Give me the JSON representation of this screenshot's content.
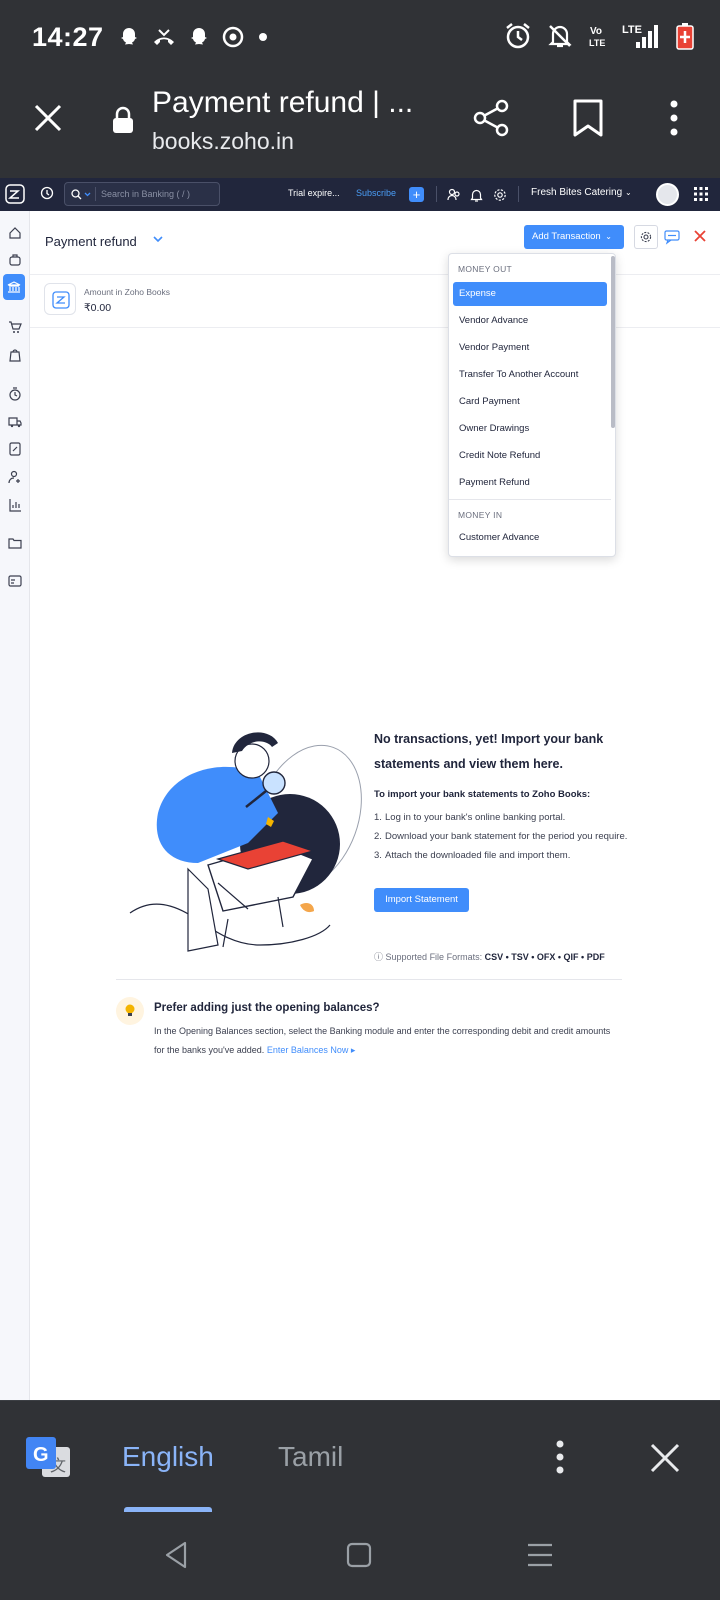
{
  "status_bar": {
    "time": "14:27",
    "left_icons": [
      "snapchat-icon",
      "missed-call-icon",
      "snapchat-icon",
      "chrome-icon",
      "dot-icon"
    ],
    "right_icons": [
      "alarm-icon",
      "mute-icon",
      "volte-icon",
      "lte-signal-icon",
      "battery-icon"
    ],
    "volte_label": "Vo LTE",
    "lte_label": "LTE"
  },
  "browser": {
    "title": "Payment refund | ...",
    "url": "books.zoho.in"
  },
  "zoho_top": {
    "search_placeholder": "Search in Banking ( / )",
    "trial_text": "Trial expire...",
    "subscribe_label": "Subscribe",
    "org_name": "Fresh Bites Catering"
  },
  "page": {
    "title": "Payment refund",
    "add_transaction_label": "Add Transaction",
    "amount_label": "Amount in Zoho Books",
    "amount_value": "₹0.00"
  },
  "dropdown": {
    "money_out_header": "MONEY OUT",
    "money_out_items": [
      "Expense",
      "Vendor Advance",
      "Vendor Payment",
      "Transfer To Another Account",
      "Card Payment",
      "Owner Drawings",
      "Credit Note Refund",
      "Payment Refund"
    ],
    "money_in_header": "MONEY IN",
    "money_in_items": [
      "Customer Advance"
    ],
    "selected": "Expense"
  },
  "empty_state": {
    "title": "No transactions, yet! Import your bank statements and view them here.",
    "subtitle": "To import your bank statements to Zoho Books:",
    "steps": [
      "Log in to your bank's online banking portal.",
      "Download your bank statement for the period you require.",
      "Attach the downloaded file and import them."
    ],
    "import_label": "Import Statement",
    "formats_label": "Supported File Formats:",
    "formats_value": "CSV • TSV • OFX • QIF • PDF"
  },
  "opening_balance": {
    "title": "Prefer adding just the opening balances?",
    "text": "In the Opening Balances section, select the Banking module and enter the corresponding debit and credit amounts for the banks you've added.",
    "link": "Enter Balances Now ▸"
  },
  "translate_bar": {
    "lang_active": "English",
    "lang_other": "Tamil"
  },
  "colors": {
    "accent": "#408dfb",
    "zoho_header": "#21263c",
    "android_chrome": "#303236",
    "translate_active": "#8ab4f8"
  }
}
